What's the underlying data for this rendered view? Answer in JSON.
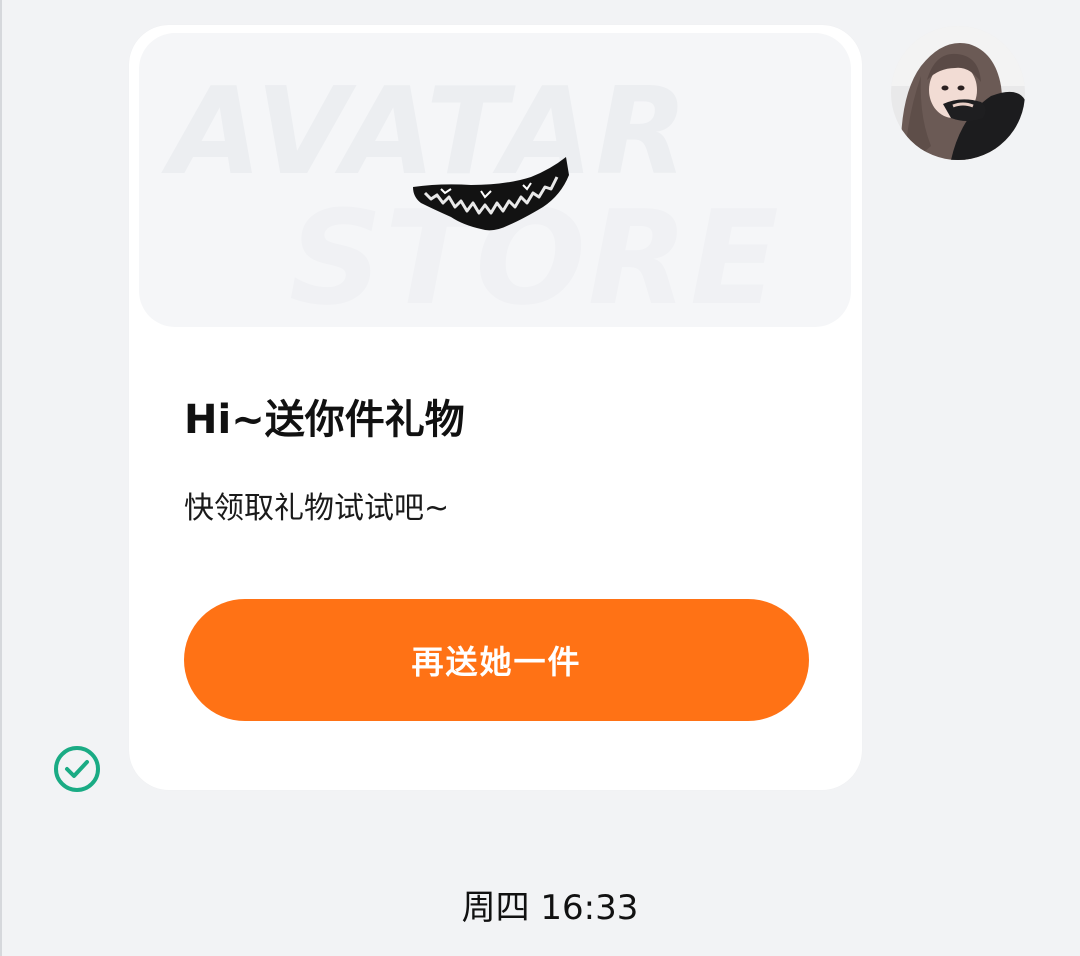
{
  "message": {
    "banner_text_line1": "AVATAR",
    "banner_text_line2": "STORE",
    "gift_icon": "vampire-fangs-icon",
    "title": "Hi~送你件礼物",
    "subtitle": "快领取礼物试试吧~",
    "button_label": "再送她一件",
    "status_icon": "check-circle-icon",
    "accent_color": "#ff7215",
    "status_color": "#1aab84"
  },
  "timestamp": {
    "text": "周四 16:33"
  }
}
